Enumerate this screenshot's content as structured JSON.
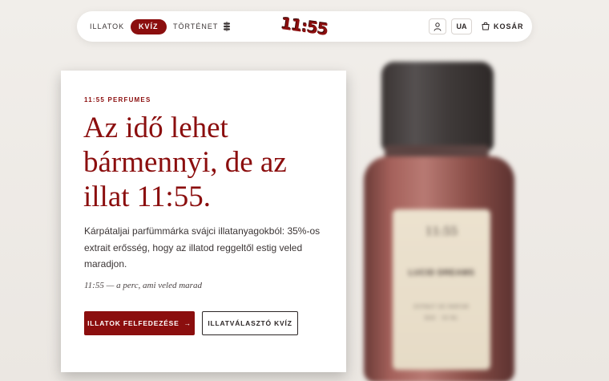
{
  "nav": {
    "links": [
      "ILLATOK",
      "KVÍZ",
      "TÖRTÉNET"
    ],
    "active_index": 1,
    "logo": "11:55",
    "lang": "UA",
    "cart_label": "KOSÁR",
    "icons": [
      "sprig-icon",
      "user-icon",
      "cart-icon"
    ]
  },
  "hero": {
    "eyebrow": "11:55 PERFUMES",
    "title": "Az idő lehet bármennyi, de az illat 11:55.",
    "lead": "Kárpátaljai parfümmárka svájci illatanyagokból: 35%-os extrait erősség, hogy az illatod reggeltől estig veled maradjon.",
    "tagline": "11:55 — a perc, ami veled marad",
    "primary_cta": "ILLATOK FELFEDEZÉSE",
    "primary_cta_icon": "arrow-right-icon",
    "secondary_cta": "ILLATVÁLASZTÓ KVÍZ"
  },
  "product_image": {
    "brand": "11:55",
    "name": "LUCID DREAMS",
    "type": "EXTRAIT DE PARFUM",
    "volume": "EDO · 50 ML"
  },
  "colors": {
    "accent": "#8b0e0e",
    "background": "#ece8e3",
    "card": "#ffffff"
  }
}
